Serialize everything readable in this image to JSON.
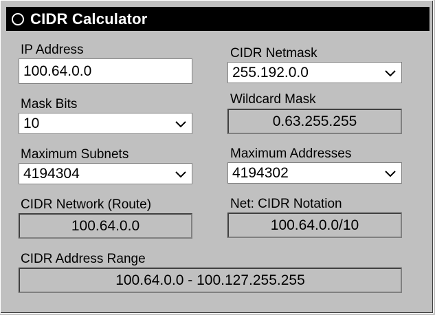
{
  "window": {
    "title": "CIDR Calculator"
  },
  "fields": {
    "ip_address": {
      "label": "IP Address",
      "value": "100.64.0.0"
    },
    "cidr_netmask": {
      "label": "CIDR Netmask",
      "value": "255.192.0.0"
    },
    "mask_bits": {
      "label": "Mask Bits",
      "value": "10"
    },
    "wildcard_mask": {
      "label": "Wildcard Mask",
      "value": "0.63.255.255"
    },
    "maximum_subnets": {
      "label": "Maximum Subnets",
      "value": "4194304"
    },
    "maximum_addresses": {
      "label": "Maximum Addresses",
      "value": "4194302"
    },
    "cidr_network": {
      "label": "CIDR Network (Route)",
      "value": "100.64.0.0"
    },
    "net_cidr_notation": {
      "label": "Net: CIDR Notation",
      "value": "100.64.0.0/10"
    },
    "cidr_address_range": {
      "label": "CIDR Address Range",
      "value": "100.64.0.0 - 100.127.255.255"
    }
  },
  "icons": {
    "title": "circle-icon",
    "dropdown": "chevron-down-icon"
  }
}
